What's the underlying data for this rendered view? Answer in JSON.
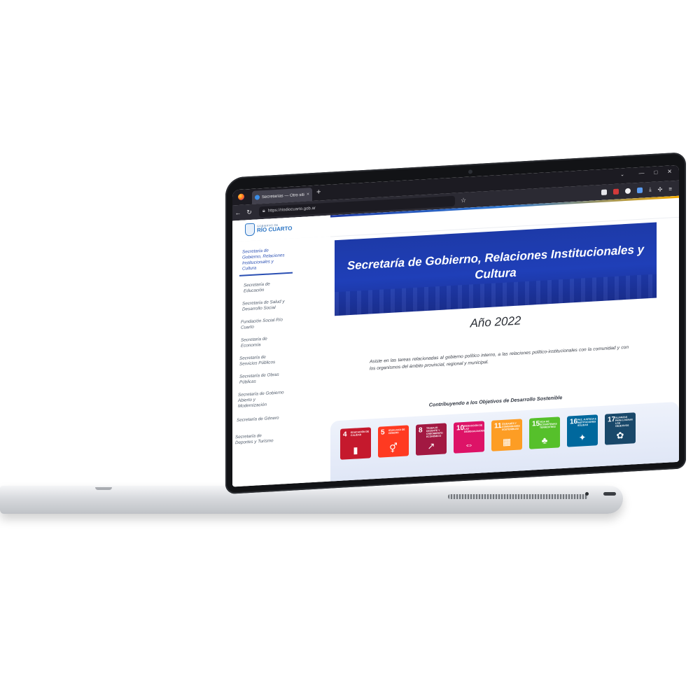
{
  "browser": {
    "tab_title": "Secretarías — Otro sitio realizado...",
    "tab_close": "×",
    "new_tab": "+",
    "url": "https://riodiocuarto.gob.ar",
    "window_controls": [
      "⌄",
      "—",
      "□",
      "✕"
    ]
  },
  "site": {
    "brand_small": "GOBIERNO DE",
    "brand_big": "RÍO CUARTO"
  },
  "sidebar": {
    "items": [
      {
        "label": "Secretaría de Gobierno, Relaciones Institucionales y Cultura",
        "active": true
      },
      {
        "label": "Secretaría de Educación",
        "active": false
      },
      {
        "label": "Secretaría de Salud y Desarrollo Social",
        "active": false
      },
      {
        "label": "Fundación Social Río Cuarto",
        "active": false
      },
      {
        "label": "Secretaría de Economía",
        "active": false
      },
      {
        "label": "Secretaría de Servicios Públicos",
        "active": false
      },
      {
        "label": "Secretaría de Obras Públicas",
        "active": false
      },
      {
        "label": "Secretaría de Gobierno Abierto y Modernización",
        "active": false
      },
      {
        "label": "Secretaría de Género",
        "active": false
      },
      {
        "label": "Secretaría de Deportes y Turismo",
        "active": false
      }
    ]
  },
  "main": {
    "banner_title": "Secretaría de Gobierno, Relaciones Institucionales y Cultura",
    "year": "Año 2022",
    "description": "Asiste en las tareas relacionadas al gobierno político interno, a las relaciones político-institucionales con la comunidad y con los organismos del ámbito provincial, regional y municipal.",
    "ods_heading": "Contribuyendo a los Objetivos de Desarrollo Sostenible",
    "sdgs": [
      {
        "num": "4",
        "label": "EDUCACIÓN DE CALIDAD",
        "color": "#c5192d",
        "icon": "book-icon",
        "glyph": "▮"
      },
      {
        "num": "5",
        "label": "IGUALDAD DE GÉNERO",
        "color": "#ff3a21",
        "icon": "gender-icon",
        "glyph": "⚥"
      },
      {
        "num": "8",
        "label": "TRABAJO DECENTE Y CRECIMIENTO ECONÓMICO",
        "color": "#a21942",
        "icon": "growth-icon",
        "glyph": "↗"
      },
      {
        "num": "10",
        "label": "REDUCCIÓN DE LAS DESIGUALDADES",
        "color": "#dd1367",
        "icon": "equality-icon",
        "glyph": "⇔"
      },
      {
        "num": "11",
        "label": "CIUDADES Y COMUNIDADES SOSTENIBLES",
        "color": "#fd9d24",
        "icon": "city-icon",
        "glyph": "▦"
      },
      {
        "num": "15",
        "label": "VIDA DE ECOSISTEMAS TERRESTRES",
        "color": "#56c02b",
        "icon": "tree-icon",
        "glyph": "♣"
      },
      {
        "num": "16",
        "label": "PAZ, JUSTICIA E INSTITUCIONES SÓLIDAS",
        "color": "#00689d",
        "icon": "dove-icon",
        "glyph": "✦"
      },
      {
        "num": "17",
        "label": "ALIANZAS PARA LOGRAR LOS OBJETIVOS",
        "color": "#19486a",
        "icon": "partnership-icon",
        "glyph": "✿"
      }
    ]
  }
}
